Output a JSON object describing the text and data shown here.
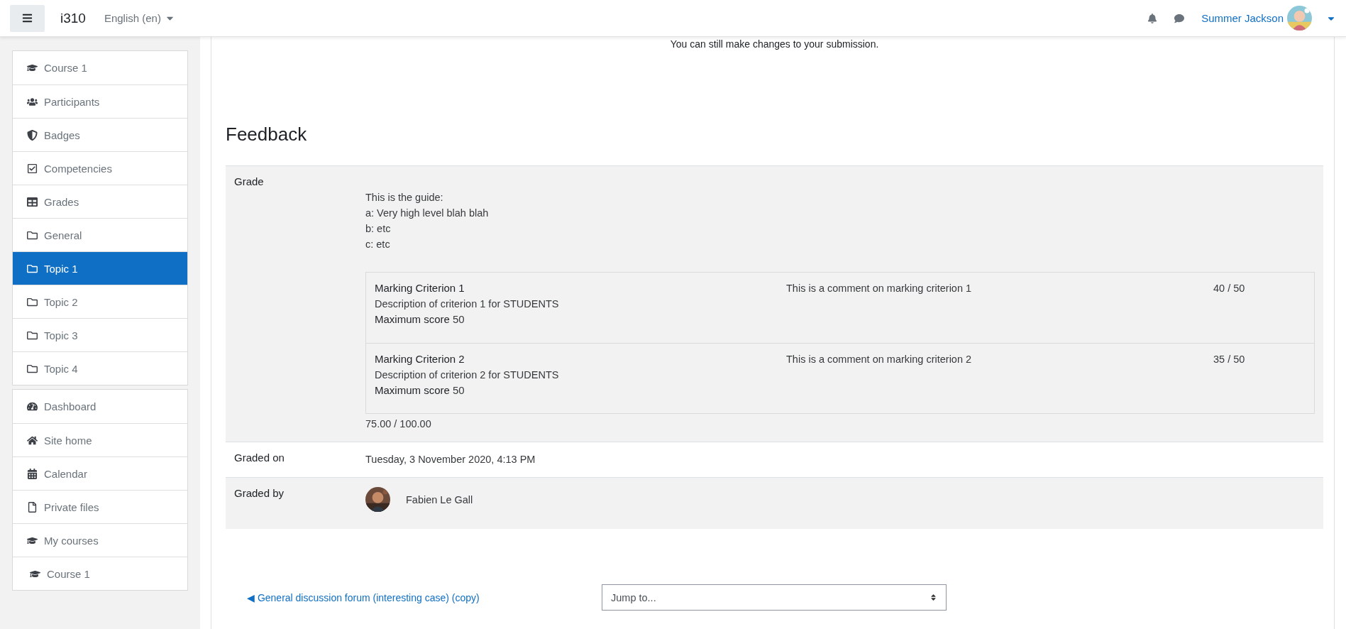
{
  "navbar": {
    "site_name": "i310",
    "language": "English (en)",
    "user_name": "Summer Jackson"
  },
  "sidebar": {
    "groups": [
      {
        "items": [
          {
            "label": "Course 1",
            "selected": false
          },
          {
            "label": "Participants",
            "selected": false
          },
          {
            "label": "Badges",
            "selected": false
          },
          {
            "label": "Competencies",
            "selected": false
          },
          {
            "label": "Grades",
            "selected": false
          },
          {
            "label": "General",
            "selected": false
          },
          {
            "label": "Topic 1",
            "selected": true
          },
          {
            "label": "Topic 2",
            "selected": false
          },
          {
            "label": "Topic 3",
            "selected": false
          },
          {
            "label": "Topic 4",
            "selected": false
          }
        ]
      },
      {
        "items": [
          {
            "label": "Dashboard",
            "selected": false
          },
          {
            "label": "Site home",
            "selected": false
          },
          {
            "label": "Calendar",
            "selected": false
          },
          {
            "label": "Private files",
            "selected": false
          },
          {
            "label": "My courses",
            "selected": false,
            "children": [
              {
                "label": "Course 1",
                "selected": false
              }
            ]
          }
        ]
      }
    ]
  },
  "submission_note": "You can still make changes to your submission.",
  "feedback": {
    "heading": "Feedback",
    "grade": {
      "label": "Grade",
      "guide": [
        "This is the guide:",
        "a: Very high level blah blah",
        "b: etc",
        "c: etc"
      ],
      "criteria": [
        {
          "title": "Marking Criterion 1",
          "description": "Description of criterion 1 for STUDENTS",
          "max_label": "Maximum score",
          "max_value": "50",
          "comment": "This is a comment on marking criterion 1",
          "score": "40 / 50"
        },
        {
          "title": "Marking Criterion 2",
          "description": "Description of criterion 2 for STUDENTS",
          "max_label": "Maximum score",
          "max_value": "50",
          "comment": "This is a comment on marking criterion 2",
          "score": "35 / 50"
        }
      ],
      "total": "75.00 / 100.00"
    },
    "graded_on": {
      "label": "Graded on",
      "value": "Tuesday, 3 November 2020, 4:13 PM"
    },
    "graded_by": {
      "label": "Graded by",
      "value": "Fabien Le Gall"
    }
  },
  "footer": {
    "prev_link": "General discussion forum (interesting case) (copy)",
    "prev_arrow": "◀",
    "jump_select": {
      "value": "Jump to..."
    }
  }
}
